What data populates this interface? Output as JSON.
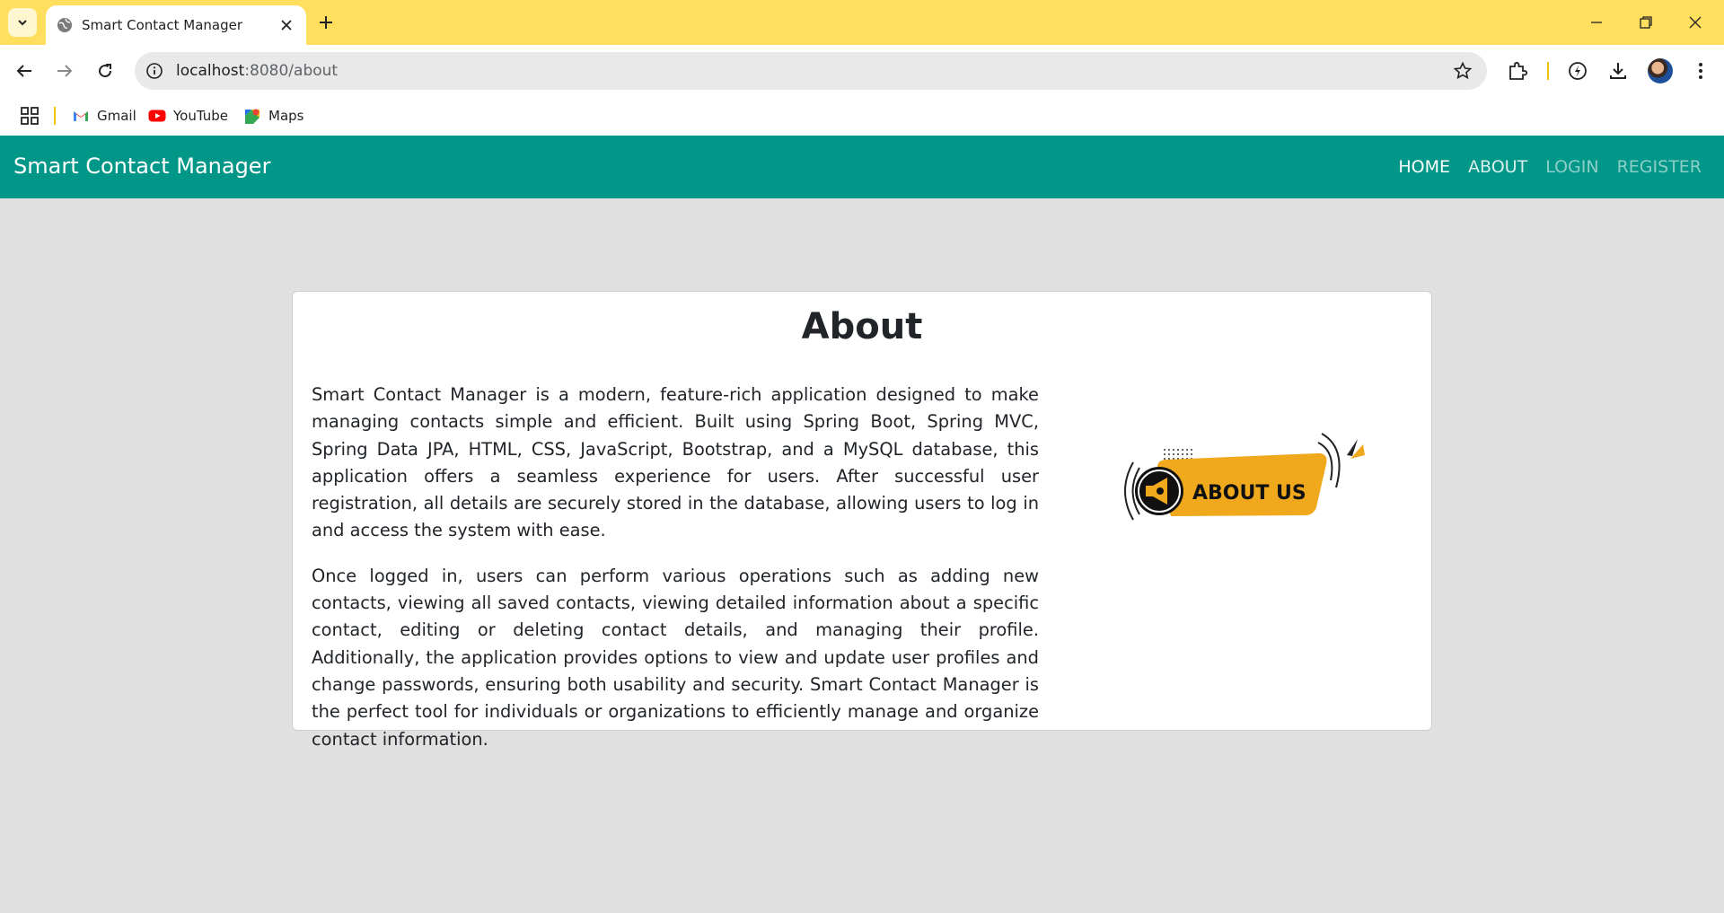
{
  "browser": {
    "tab": {
      "title": "Smart Contact Manager"
    },
    "address_bar": {
      "url_host": "localhost",
      "url_rest": ":8080/about"
    },
    "bookmarks": [
      {
        "label": "Gmail",
        "icon": "gmail-icon"
      },
      {
        "label": "YouTube",
        "icon": "youtube-icon"
      },
      {
        "label": "Maps",
        "icon": "maps-icon"
      }
    ]
  },
  "navbar": {
    "brand": "Smart Contact Manager",
    "links": [
      {
        "label": "HOME"
      },
      {
        "label": "ABOUT"
      },
      {
        "label": "LOGIN"
      },
      {
        "label": "REGISTER"
      }
    ],
    "color": "#009688"
  },
  "about": {
    "title": "About",
    "paragraphs": [
      "Smart Contact Manager is a modern, feature-rich application designed to make managing contacts simple and efficient. Built using Spring Boot, Spring MVC, Spring Data JPA, HTML, CSS, JavaScript, Bootstrap, and a MySQL database, this application offers a seamless experience for users. After successful user registration, all details are securely stored in the database, allowing users to log in and access the system with ease.",
      "Once logged in, users can perform various operations such as adding new contacts, viewing all saved contacts, viewing detailed information about a specific contact, editing or deleting contact details, and managing their profile. Additionally, the application provides options to view and update user profiles and change passwords, ensuring both usability and security. Smart Contact Manager is the perfect tool for individuals or organizations to efficiently manage and organize contact information."
    ],
    "image_text": "ABOUT US",
    "image_color": "#f0a81c"
  }
}
